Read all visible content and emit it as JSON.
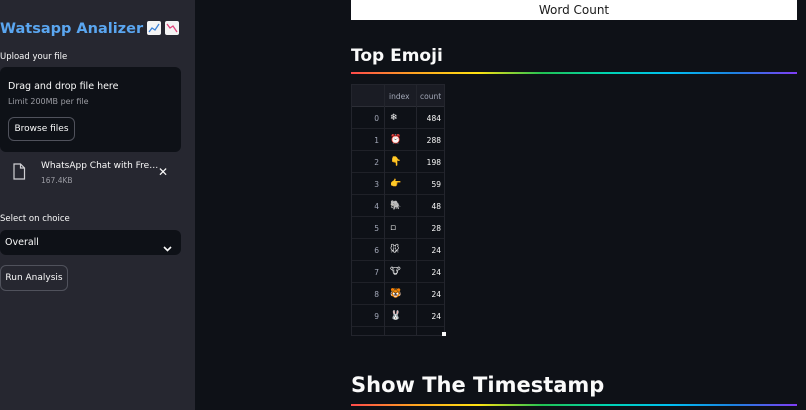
{
  "sidebar": {
    "title": "Watsapp Analizer",
    "title_icons": [
      "chart-increasing-icon",
      "chart-decreasing-icon"
    ],
    "upload_label": "Upload your file",
    "dropzone": {
      "title": "Drag and drop file here",
      "limit": "Limit 200MB per file",
      "browse_label": "Browse files"
    },
    "file": {
      "name": "WhatsApp Chat with Fres...",
      "size": "167.4KB"
    },
    "select_label": "Select on choice",
    "select_value": "Overall",
    "run_label": "Run Analysis"
  },
  "main": {
    "wordcloud_caption": "Word Count",
    "top_emoji_title": "Top Emoji",
    "table": {
      "columns": [
        "index",
        "count"
      ],
      "rows": [
        {
          "idx": "0",
          "emoji": "❄",
          "count": "484"
        },
        {
          "idx": "1",
          "emoji": "⏰",
          "count": "288"
        },
        {
          "idx": "2",
          "emoji": "👇",
          "count": "198"
        },
        {
          "idx": "3",
          "emoji": "👉",
          "count": "59"
        },
        {
          "idx": "4",
          "emoji": "🐘",
          "count": "48"
        },
        {
          "idx": "5",
          "emoji": "▫",
          "count": "28"
        },
        {
          "idx": "6",
          "emoji": "🐭",
          "count": "24"
        },
        {
          "idx": "7",
          "emoji": "🐮",
          "count": "24"
        },
        {
          "idx": "8",
          "emoji": "🐯",
          "count": "24"
        },
        {
          "idx": "9",
          "emoji": "🐰",
          "count": "24"
        }
      ]
    },
    "timestamp_title": "Show The Timestamp"
  },
  "colors": {
    "background": "#0e1117",
    "sidebar": "#262730",
    "title_accent": "#5aa6f0",
    "text": "#fafafa"
  }
}
